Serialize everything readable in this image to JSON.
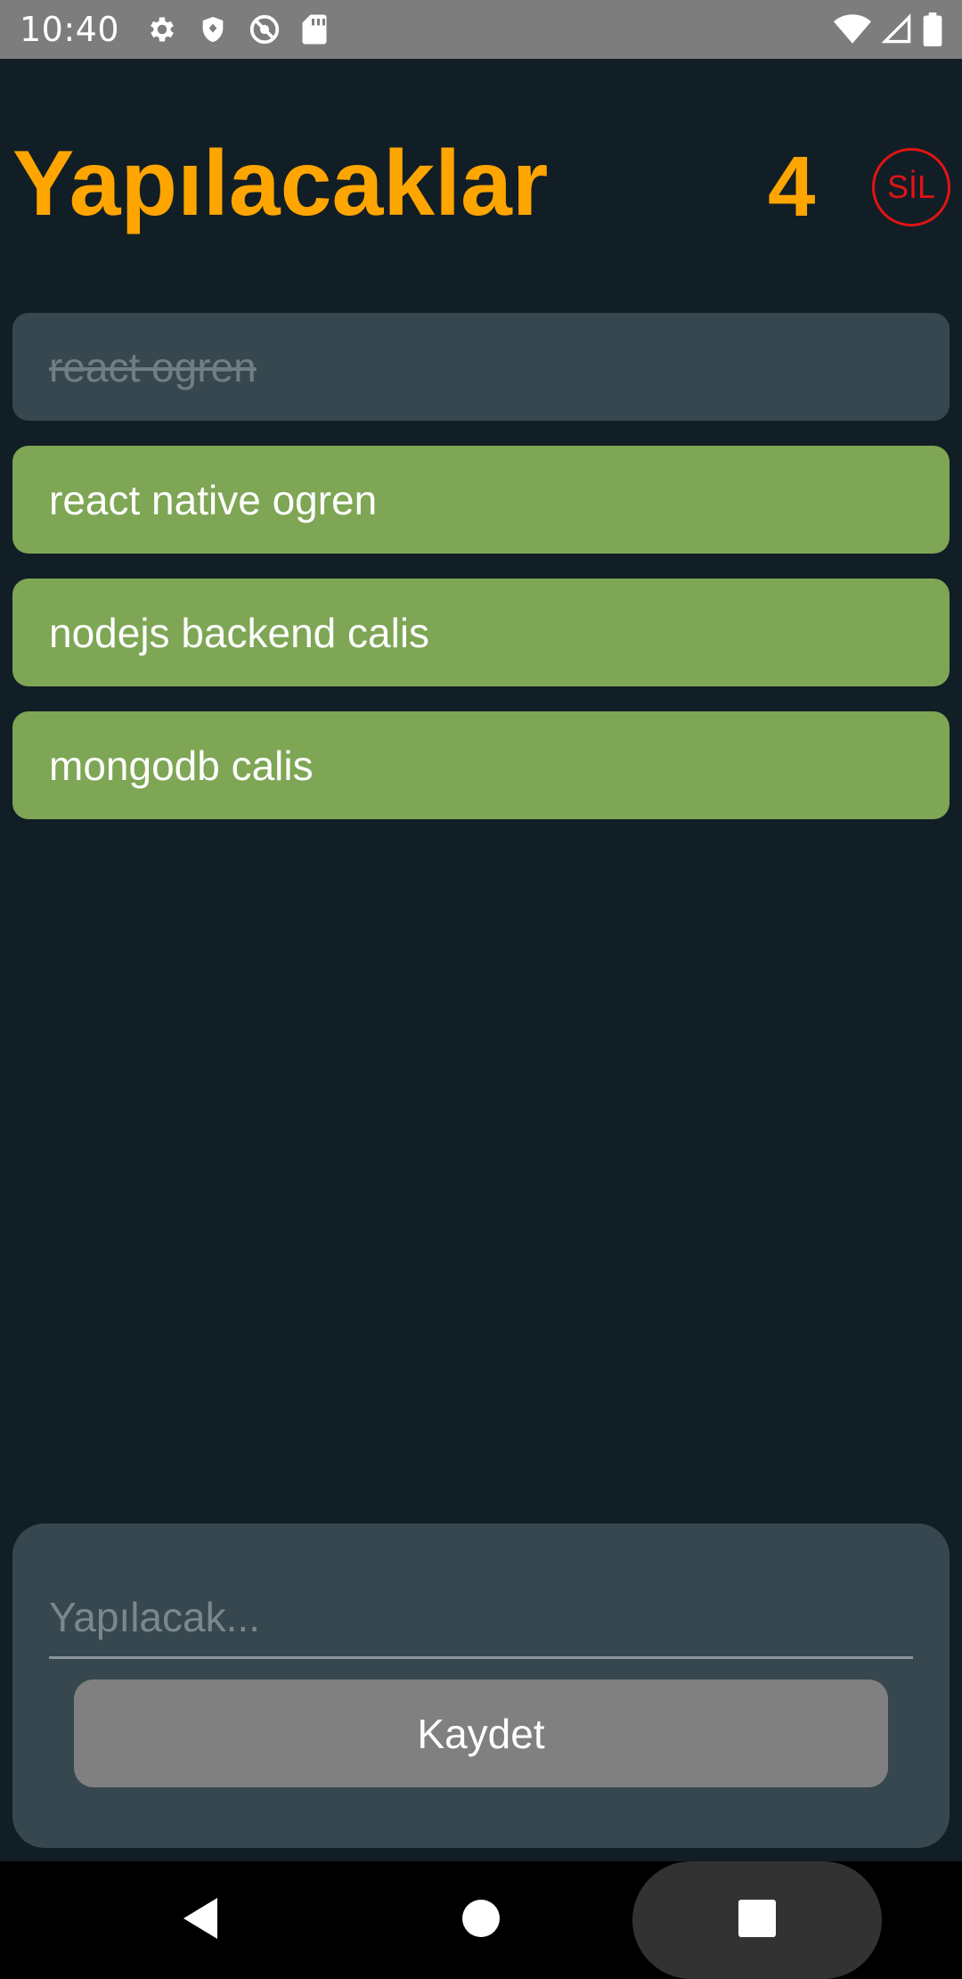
{
  "status_bar": {
    "time": "10:40",
    "icons_left": [
      "settings-icon",
      "shield-icon",
      "location-off-icon",
      "sd-card-icon"
    ],
    "icons_right": [
      "wifi-icon",
      "signal-icon",
      "battery-icon"
    ]
  },
  "header": {
    "title": "Yapılacaklar",
    "count": "4",
    "delete_label": "SİL",
    "title_color": "#ffa500",
    "delete_color": "#e01414"
  },
  "todos": [
    {
      "text": "react ogren",
      "done": true
    },
    {
      "text": "react native ogren",
      "done": false
    },
    {
      "text": "nodejs backend calis",
      "done": false
    },
    {
      "text": "mongodb calis",
      "done": false
    }
  ],
  "input_panel": {
    "placeholder": "Yapılacak...",
    "value": "",
    "save_label": "Kaydet"
  },
  "nav_bar": {
    "buttons": [
      "back-icon",
      "home-icon",
      "recents-icon"
    ]
  },
  "colors": {
    "background": "#121e25",
    "done_item": "#37474f",
    "active_item": "#7ea655",
    "panel": "#37474f",
    "button": "#808080"
  }
}
